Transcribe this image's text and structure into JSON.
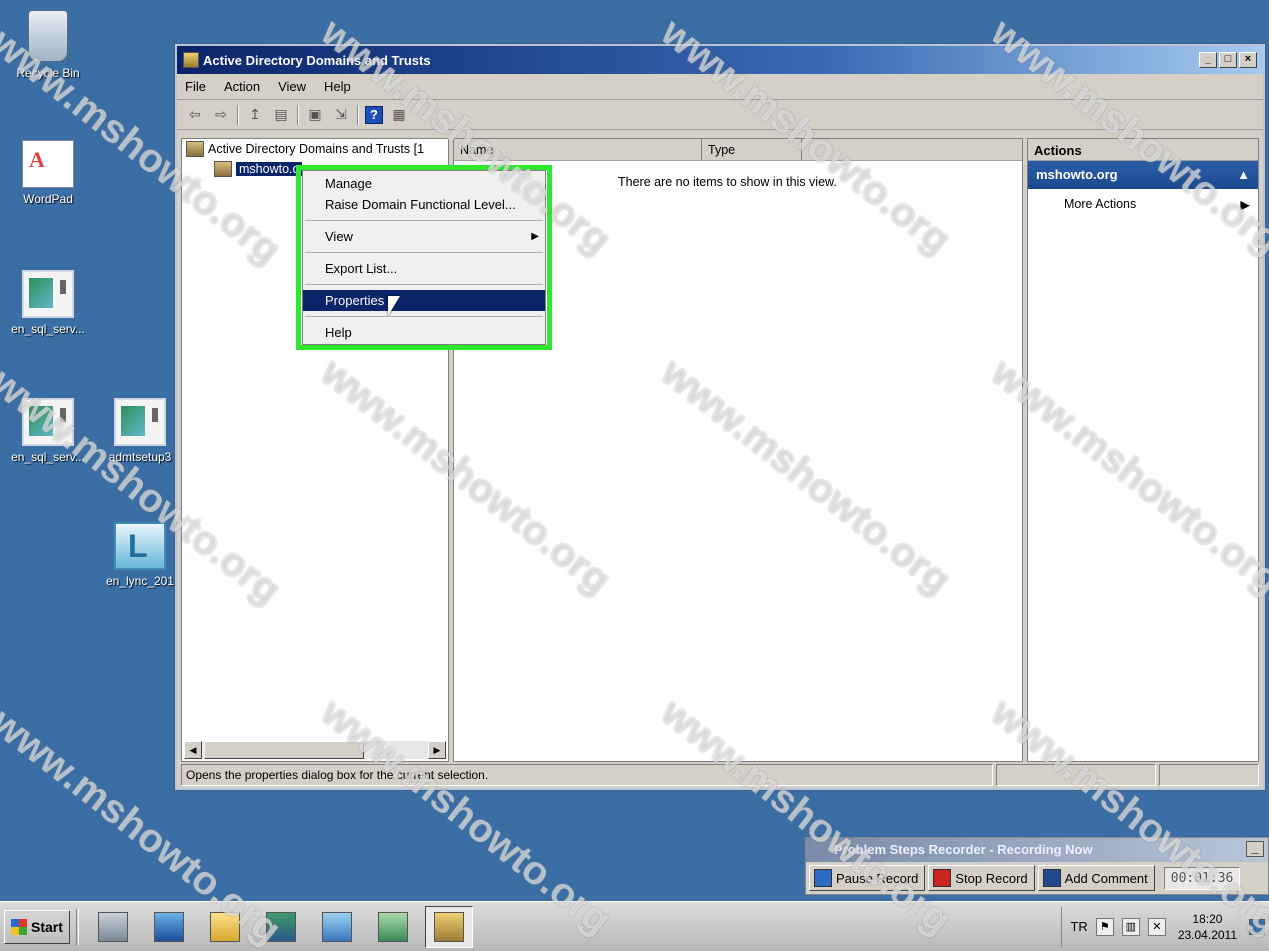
{
  "desktop": {
    "icons": [
      {
        "label": "Recycle Bin",
        "icon": "recycle-bin-icon"
      },
      {
        "label": "WordPad",
        "icon": "wordpad-icon"
      },
      {
        "label": "en_sql_serv...",
        "icon": "installer-icon"
      },
      {
        "label": "en_sql_serv...",
        "icon": "installer-icon"
      },
      {
        "label": "admtsetup3",
        "icon": "installer-icon"
      },
      {
        "label": "en_lync_201",
        "icon": "lync-icon"
      }
    ]
  },
  "window": {
    "title": "Active Directory Domains and Trusts",
    "controls": {
      "minimize": "_",
      "maximize": "□",
      "close": "×"
    },
    "menu": [
      "File",
      "Action",
      "View",
      "Help"
    ],
    "tree": {
      "root": "Active Directory Domains and Trusts [1",
      "child": "mshowto.o"
    },
    "list": {
      "columns": [
        "Name",
        "Type"
      ],
      "empty_message": "There are no items to show in this view."
    },
    "actions": {
      "header": "Actions",
      "group": "mshowto.org",
      "items": [
        "More Actions"
      ]
    },
    "status": "Opens the properties dialog box for the current selection."
  },
  "context_menu": {
    "items": [
      "Manage",
      "Raise Domain Functional Level...",
      "View",
      "Export List...",
      "Properties",
      "Help"
    ],
    "selected": "Properties"
  },
  "steps_recorder": {
    "title": "Problem Steps Recorder - Recording Now",
    "pause": "Pause Record",
    "stop": "Stop Record",
    "comment": "Add Comment",
    "timer": "00:01:36"
  },
  "taskbar": {
    "start": "Start",
    "language": "TR",
    "time": "18:20",
    "date": "23.04.2011"
  },
  "watermark": "www.mshowto.org",
  "colors": {
    "desktop": "#3a6ea5",
    "highlight_box": "#2ee82e",
    "selection": "#0a246a"
  }
}
